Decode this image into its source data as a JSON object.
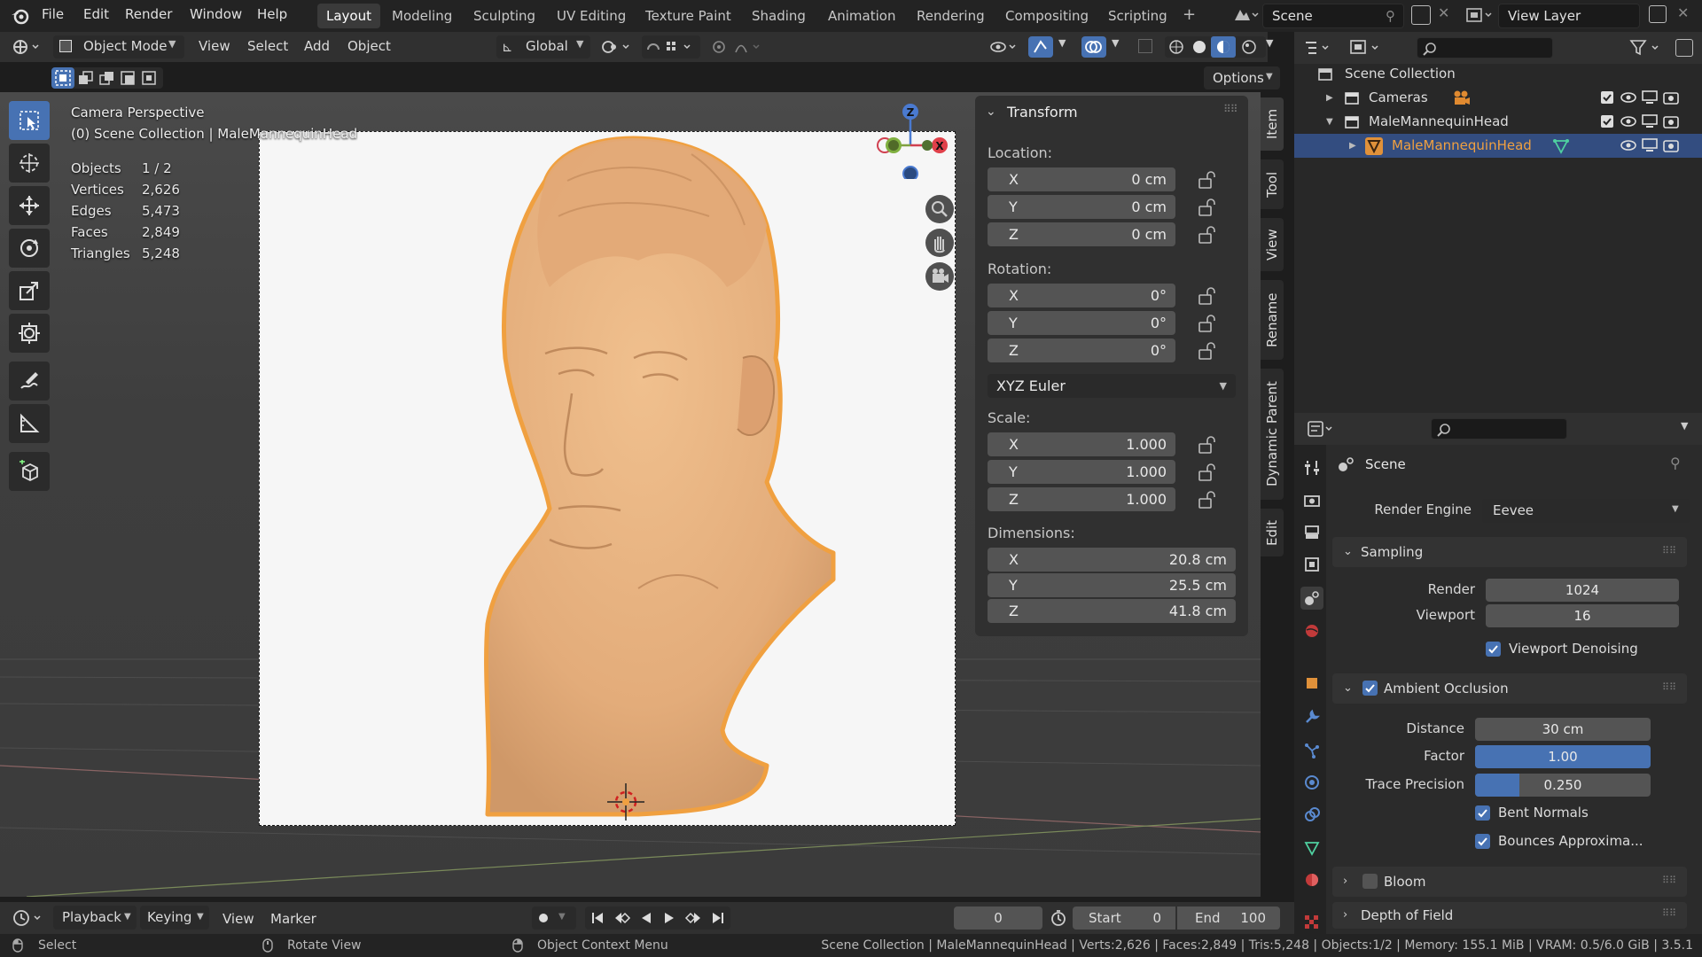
{
  "app": {
    "logo": "blender-logo-icon"
  },
  "menu": {
    "items": [
      "File",
      "Edit",
      "Render",
      "Window",
      "Help"
    ]
  },
  "workspaces": {
    "tabs": [
      "Layout",
      "Modeling",
      "Sculpting",
      "UV Editing",
      "Texture Paint",
      "Shading",
      "Animation",
      "Rendering",
      "Compositing",
      "Scripting"
    ],
    "active": "Layout"
  },
  "scene": {
    "name": "Scene",
    "view_layer": "View Layer"
  },
  "viewport_header": {
    "mode": "Object Mode",
    "menus": [
      "View",
      "Select",
      "Add",
      "Object"
    ],
    "orientation": "Global",
    "options_label": "Options"
  },
  "viewport": {
    "camera_label": "Camera Perspective",
    "collection_label": "(0) Scene Collection | MaleMannequinHead",
    "stats": [
      {
        "label": "Objects",
        "value": "1 / 2"
      },
      {
        "label": "Vertices",
        "value": "2,626"
      },
      {
        "label": "Edges",
        "value": "5,473"
      },
      {
        "label": "Faces",
        "value": "2,849"
      },
      {
        "label": "Triangles",
        "value": "5,248"
      }
    ],
    "gizmo": {
      "z": "Z",
      "x": "X"
    },
    "colors": {
      "selection_outline": "#f0a040",
      "model": "#e8b07e",
      "active_tool": "#4772b3"
    }
  },
  "transform_panel": {
    "title": "Transform",
    "location_label": "Location:",
    "location": [
      {
        "axis": "X",
        "value": "0 cm"
      },
      {
        "axis": "Y",
        "value": "0 cm"
      },
      {
        "axis": "Z",
        "value": "0 cm"
      }
    ],
    "rotation_label": "Rotation:",
    "rotation": [
      {
        "axis": "X",
        "value": "0°"
      },
      {
        "axis": "Y",
        "value": "0°"
      },
      {
        "axis": "Z",
        "value": "0°"
      }
    ],
    "rotation_mode": "XYZ Euler",
    "scale_label": "Scale:",
    "scale": [
      {
        "axis": "X",
        "value": "1.000"
      },
      {
        "axis": "Y",
        "value": "1.000"
      },
      {
        "axis": "Z",
        "value": "1.000"
      }
    ],
    "dimensions_label": "Dimensions:",
    "dimensions": [
      {
        "axis": "X",
        "value": "20.8 cm"
      },
      {
        "axis": "Y",
        "value": "25.5 cm"
      },
      {
        "axis": "Z",
        "value": "41.8 cm"
      }
    ]
  },
  "sidebar_tabs": [
    "Item",
    "Tool",
    "View",
    "Rename",
    "Dynamic Parent",
    "Edit"
  ],
  "outliner": {
    "root": "Scene Collection",
    "rows": [
      {
        "name": "Cameras",
        "icon": "camera-icon"
      },
      {
        "name": "MaleMannequinHead",
        "icon": "collection-icon"
      },
      {
        "name": "MaleMannequinHead",
        "icon": "mesh-icon",
        "selected": true
      }
    ]
  },
  "properties": {
    "context": "Scene",
    "render_engine_label": "Render Engine",
    "render_engine": "Eevee",
    "sampling": {
      "title": "Sampling",
      "render_label": "Render",
      "render": "1024",
      "viewport_label": "Viewport",
      "viewport": "16",
      "denoise_label": "Viewport Denoising"
    },
    "ao": {
      "title": "Ambient Occlusion",
      "distance_label": "Distance",
      "distance": "30 cm",
      "factor_label": "Factor",
      "factor": "1.00",
      "factor_fill": 1.0,
      "precision_label": "Trace Precision",
      "precision": "0.250",
      "precision_fill": 0.25,
      "bent_normals": "Bent Normals",
      "bounces": "Bounces Approxima..."
    },
    "bloom": "Bloom",
    "dof": "Depth of Field"
  },
  "timeline": {
    "menus": [
      "Playback",
      "Keying",
      "View",
      "Marker"
    ],
    "current_frame": "0",
    "start_label": "Start",
    "start": "0",
    "end_label": "End",
    "end": "100"
  },
  "statusbar": {
    "select": "Select",
    "rotate": "Rotate View",
    "context_menu": "Object Context Menu",
    "info": "Scene Collection | MaleMannequinHead | Verts:2,626 | Faces:2,849 | Tris:5,248 | Objects:1/2 | Memory: 155.1 MiB | VRAM: 0.5/6.0 GiB | 3.5.1"
  }
}
